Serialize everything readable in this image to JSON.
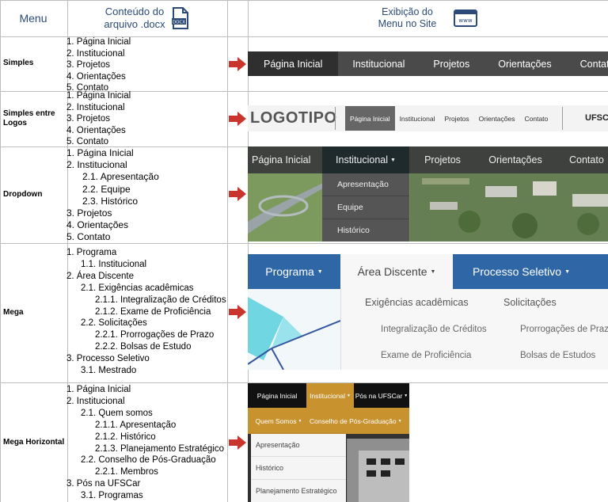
{
  "header": {
    "menu": "Menu",
    "doc_line1": "Conteúdo do",
    "doc_line2": "arquivo .docx",
    "doc_icon_text": "DOCX",
    "site_line1": "Exibição do",
    "site_line2": "Menu no Site",
    "site_icon_text": "www"
  },
  "rows": [
    {
      "label": "Simples",
      "doc": [
        "1.   Página Inicial",
        "2.   Institucional",
        "3.   Projetos",
        "4.   Orientações",
        "5.   Contato"
      ]
    },
    {
      "label_line1": "Simples entre",
      "label_line2": "Logos",
      "doc": [
        "1.   Página Inicial",
        "2.   Institucional",
        "3.   Projetos",
        "4.   Orientações",
        "5.   Contato"
      ]
    },
    {
      "label": "Dropdown",
      "doc": [
        "1.   Página Inicial",
        "2.   Institucional",
        "2.1. Apresentação",
        "2.2. Equipe",
        "2.3. Histórico",
        "3.   Projetos",
        "4.   Orientações",
        "5.   Contato"
      ]
    },
    {
      "label": "Mega",
      "doc": [
        "1.   Programa",
        "1.1. Institucional",
        "2.   Área Discente",
        "2.1. Exigências acadêmicas",
        "2.1.1.   Integralização de Créditos",
        "2.1.2.   Exame de Proficiência",
        "2.2. Solicitações",
        "2.2.1.   Prorrogações de Prazo",
        "2.2.2.   Bolsas de Estudo",
        "3.   Processo Seletivo",
        "3.1. Mestrado"
      ]
    },
    {
      "label": "Mega Horizontal",
      "doc": [
        "1.   Página Inicial",
        "2.   Institucional",
        "2.1. Quem somos",
        "2.1.1.   Apresentação",
        "2.1.2.   Histórico",
        "2.1.3.   Planejamento Estratégico",
        "2.2. Conselho de Pós-Graduação",
        "2.2.1.   Membros",
        "3.   Pós na UFSCar",
        "3.1. Programas"
      ]
    }
  ],
  "menu_simple": [
    "Página Inicial",
    "Institucional",
    "Projetos",
    "Orientações",
    "Contato"
  ],
  "menu_logos": {
    "logo": "LOGOTIPO",
    "items": [
      "Página Inicial",
      "Institucional",
      "Projetos",
      "Orientações",
      "Contato"
    ],
    "logo2": "UFSCar"
  },
  "menu_dropdown": {
    "items": [
      "Página Inicial",
      "Institucional",
      "Projetos",
      "Orientações",
      "Contato"
    ],
    "sub": [
      "Apresentação",
      "Equipe",
      "Histórico"
    ]
  },
  "menu_mega": {
    "tabs": [
      "Programa",
      "Área Discente",
      "Processo Seletivo"
    ],
    "col1_title": "Exigências acadêmicas",
    "col2_title": "Solicitações",
    "col1": [
      "Integralização de Créditos",
      "Exame de Proficiência"
    ],
    "col2": [
      "Prorrogações de Prazo",
      "Bolsas de Estudos"
    ]
  },
  "menu_mega_h": {
    "top": [
      "Página Inicial",
      "Institucional",
      "Pós na UFSCar"
    ],
    "second": [
      "Quem Somos",
      "Conselho de Pós-Graduação"
    ],
    "sub": [
      "Apresentação",
      "Histórico",
      "Planejamento Estratégico"
    ]
  },
  "colors": {
    "header_text": "#2b4a78",
    "arrow": "#c9352c",
    "mega_blue": "#2f67a6",
    "gold": "#c8922f"
  }
}
